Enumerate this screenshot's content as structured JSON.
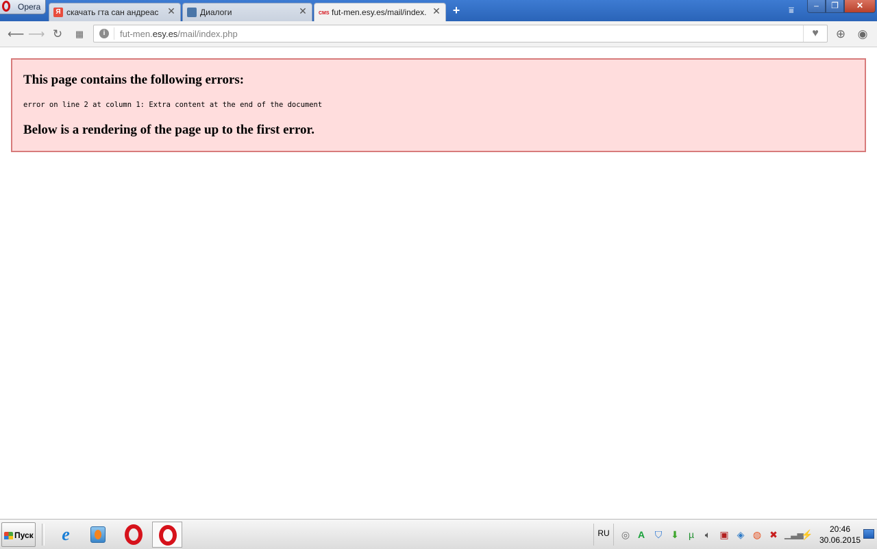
{
  "browser": {
    "menu_label": "Opera",
    "tabs": [
      {
        "title": "скачать гта сан андреас ч",
        "favicon_text": "Я",
        "favicon_color": "#ffffff",
        "favicon_bg": "#e84c3d",
        "active": false
      },
      {
        "title": "Диалоги",
        "favicon_text": "",
        "favicon_color": "#ffffff",
        "favicon_bg": "#4a76a8",
        "active": false
      },
      {
        "title": "fut-men.esy.es/mail/index.",
        "favicon_text": "CMS",
        "favicon_color": "#d6121b",
        "favicon_bg": "transparent",
        "active": true
      }
    ],
    "close_glyph": "✕",
    "new_tab_glyph": "+",
    "address": {
      "prefix": "fut-men.",
      "domain": "esy.es",
      "path": "/mail/index.php"
    },
    "window_buttons": {
      "min": "–",
      "max": "❐",
      "close": "✕"
    }
  },
  "page": {
    "heading": "This page contains the following errors:",
    "error_message": "error on line 2 at column 1: Extra content at the end of the document",
    "subheading": "Below is a rendering of the page up to the first error."
  },
  "taskbar": {
    "start_label": "Пуск",
    "language": "RU",
    "time": "20:46",
    "date": "30.06.2015"
  },
  "colors": {
    "error_bg": "#ffdddd",
    "error_border": "#d77b7b",
    "tabbar_blue": "#2a64b8"
  },
  "icons": [
    "back-icon",
    "forward-icon",
    "reload-icon",
    "speed-dial-icon",
    "site-info-icon",
    "heart-icon",
    "download-icon",
    "account-icon"
  ]
}
